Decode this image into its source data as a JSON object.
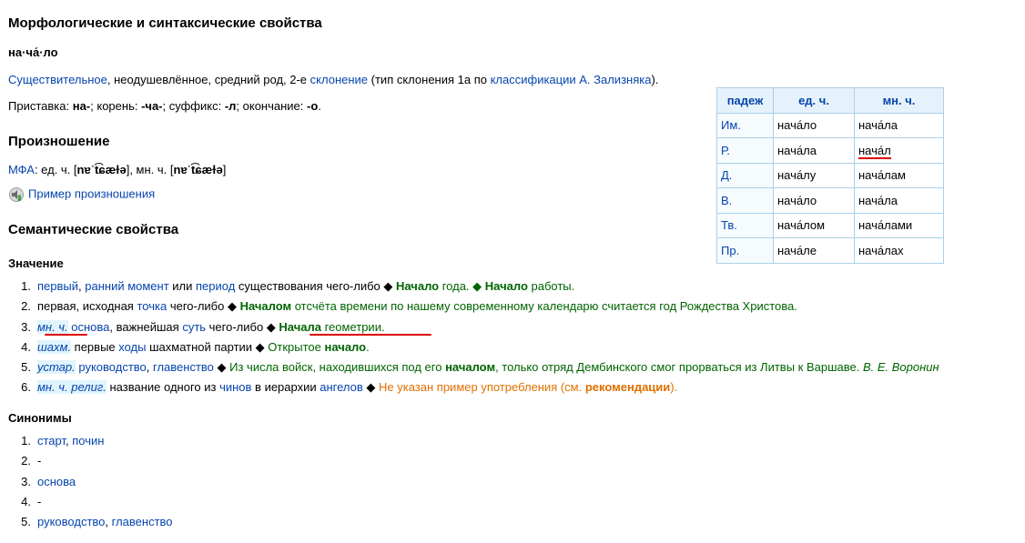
{
  "sections": {
    "morph_title": "Морфологические и синтаксические свойства",
    "pron_title": "Произношение",
    "sem_title": "Семантические свойства",
    "meaning_title": "Значение",
    "synonyms_title": "Синонимы"
  },
  "morph": {
    "word": "на·ча́·ло",
    "line1_link1": "Существительное",
    "line1_text1": ", неодушевлённое, средний род, 2-е ",
    "line1_link2": "склонение",
    "line1_text2": " (тип склонения 1a по ",
    "line1_link3": "классификации А. Зализняка",
    "line1_text3": ").",
    "line2_p1": "Приставка: ",
    "line2_b1": "на-",
    "line2_p2": "; корень: ",
    "line2_b2": "-ча-",
    "line2_p3": "; суффикс: ",
    "line2_b3": "-л",
    "line2_p4": "; окончание: ",
    "line2_b4": "-о",
    "line2_p5": "."
  },
  "pron": {
    "ipa_link": "МФА",
    "ipa_text1": ": ед. ч. [",
    "ipa_sg": "nɐˈt͡ɕæɫə",
    "ipa_text2": "], мн. ч. [",
    "ipa_pl": "nɐˈt͡ɕæɫə",
    "ipa_text3": "]",
    "audio_link": "Пример произношения"
  },
  "table": {
    "headers": [
      "падеж",
      "ед. ч.",
      "мн. ч."
    ],
    "rows": [
      [
        "Им.",
        "нача́ло",
        "нача́ла"
      ],
      [
        "Р.",
        "нача́ла",
        "нача́л"
      ],
      [
        "Д.",
        "нача́лу",
        "нача́лам"
      ],
      [
        "В.",
        "нача́ло",
        "нача́ла"
      ],
      [
        "Тв.",
        "нача́лом",
        "нача́лами"
      ],
      [
        "Пр.",
        "нача́ле",
        "нача́лах"
      ]
    ]
  },
  "meanings": {
    "m1": {
      "num": "1.",
      "l1": "первый",
      "c1": ", ",
      "l2": "ранний момент",
      "t1": " или ",
      "l3": "период",
      "t2": " существования чего-либо ◆ ",
      "b1": "Начало",
      "g1": " года. ◆ ",
      "b2": "Начало",
      "g2": " работы."
    },
    "m2": {
      "num": "2.",
      "t1": "первая, исходная ",
      "l1": "точка",
      "t2": " чего-либо ◆ ",
      "b1": "Началом",
      "g1": " отсчёта времени по нашему современному календарю считается год Рождества Христова."
    },
    "m3": {
      "num": "3.",
      "lab": "мн. ч.",
      "sp": " ",
      "l1": "основа",
      "t1": ", важнейшая ",
      "l2": "суть",
      "t2": " чего-либо ◆ ",
      "b1": "Начала",
      "g1": " геометрии."
    },
    "m4": {
      "num": "4.",
      "lab": "шахм.",
      "t1": " первые ",
      "l1": "ходы",
      "t2": " шахматной партии ◆ ",
      "g1": "Открытое ",
      "b1": "начало",
      "g2": "."
    },
    "m5": {
      "num": "5.",
      "lab": "устар.",
      "sp": " ",
      "l1": "руководство",
      "c1": ", ",
      "l2": "главенство",
      "t1": " ◆ ",
      "g1": "Из числа войск, находившихся под его ",
      "b1": "началом",
      "g2": ", только отряд Дембинского смог прорваться из Литвы к Варшаве. ",
      "auth": "В. Е. Воронин"
    },
    "m6": {
      "num": "6.",
      "lab1": "мн. ч.",
      "lab2": "религ.",
      "t1": " название одного из ",
      "l1": "чинов",
      "t2": " в иерархии ",
      "l2": "ангелов",
      "t3": " ◆ ",
      "o1": "Не указан пример употребления (см. ",
      "ob": "рекомендации",
      "o2": ")."
    }
  },
  "synonyms": {
    "s1": {
      "num": "1.",
      "l1": "старт",
      "c1": ", ",
      "l2": "почин"
    },
    "s2": {
      "num": "2.",
      "t": "-"
    },
    "s3": {
      "num": "3.",
      "l1": "основа"
    },
    "s4": {
      "num": "4.",
      "t": "-"
    },
    "s5": {
      "num": "5.",
      "l1": "руководство",
      "c1": ", ",
      "l2": "главенство"
    }
  },
  "colors": {
    "link": "#0645ad",
    "example": "#006400",
    "warning": "#e07000",
    "annotation": "#dd0000"
  }
}
